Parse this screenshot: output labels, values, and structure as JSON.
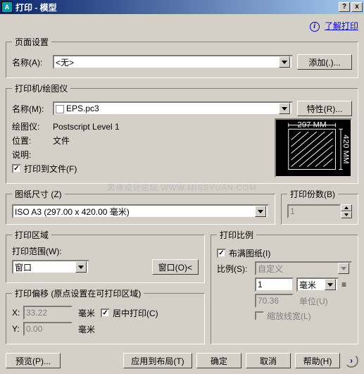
{
  "titlebar": {
    "title": "打印 - 模型",
    "help": "?",
    "close": "x"
  },
  "top": {
    "info": "i",
    "learn": "了解打印"
  },
  "page_setup": {
    "legend": "页面设置",
    "name_lbl": "名称(A):",
    "name_val": "<无>",
    "add_btn": "添加(.)..."
  },
  "printer": {
    "legend": "打印机/绘图仪",
    "name_lbl": "名称(M):",
    "name_val": "EPS.pc3",
    "props_btn": "特性(R)...",
    "plotter_lbl": "绘图仪:",
    "plotter_val": "Postscript Level 1",
    "where_lbl": "位置:",
    "where_val": "文件",
    "desc_lbl": "说明:",
    "tofile_chk": "打印到文件(F)",
    "preview": {
      "w": "297 MM",
      "h": "420 MM"
    }
  },
  "papersize": {
    "legend": "图纸尺寸 (Z)",
    "val": "ISO A3 (297.00 x 420.00 毫米)"
  },
  "copies": {
    "legend": "打印份数(B)",
    "val": "1"
  },
  "area": {
    "legend": "打印区域",
    "what_lbl": "打印范围(W):",
    "what_val": "窗口",
    "window_btn": "窗口(O)<"
  },
  "offset": {
    "legend": "打印偏移 (原点设置在可打印区域)",
    "x_lbl": "X:",
    "x_val": "33.22",
    "x_unit": "毫米",
    "y_lbl": "Y:",
    "y_val": "0.00",
    "y_unit": "毫米",
    "center_chk": "居中打印(C)"
  },
  "scale": {
    "legend": "打印比例",
    "fit_chk": "布满图纸(I)",
    "ratio_lbl": "比例(S):",
    "ratio_val": "自定义",
    "num_val": "1",
    "num_unit": "毫米",
    "den_val": "70.36",
    "den_unit": "单位(U)",
    "lw_chk": "缩放线宽(L)"
  },
  "buttons": {
    "preview": "预览(P)...",
    "apply": "应用到布局(T)",
    "ok": "确定",
    "cancel": "取消",
    "help": "帮助(H)"
  },
  "watermark": "思缘设计论坛 WWW.MISSYUAN.COM"
}
